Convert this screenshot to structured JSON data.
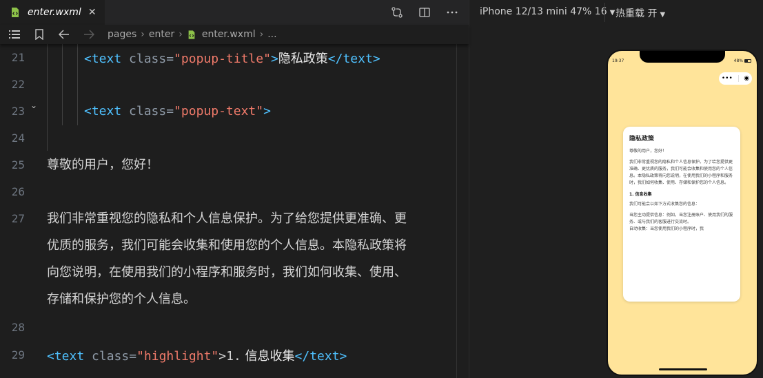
{
  "editor": {
    "tab": {
      "filename": "enter.wxml",
      "close_glyph": "✕"
    },
    "breadcrumb": {
      "items": [
        "pages",
        "enter"
      ],
      "file": "enter.wxml",
      "trail": "..."
    },
    "lines": [
      {
        "num": "21",
        "tag_open": "<text",
        "attr": "class=",
        "value": "\"popup-title\"",
        "close": ">",
        "text": "隐私政策",
        "tag_close": "</text>"
      },
      {
        "num": "22"
      },
      {
        "num": "23",
        "tag_open": "<text",
        "attr": "class=",
        "value": "\"popup-text\"",
        "close": ">"
      },
      {
        "num": "24"
      },
      {
        "num": "25",
        "prose": "尊敬的用户，您好！"
      },
      {
        "num": "26"
      },
      {
        "num": "27",
        "prose_lines": [
          "我们非常重视您的隐私和个人信息保护。为了给您提供更准确、更",
          "优质的服务，我们可能会收集和使用您的个人信息。本隐私政策将",
          "向您说明，在使用我们的小程序和服务时，我们如何收集、使用、",
          "存储和保护您的个人信息。"
        ]
      },
      {
        "num": "28"
      },
      {
        "num": "29",
        "tag_open": "<text",
        "attr": "class=",
        "value": "\"highlight\"",
        "close": ">1.",
        "text": " 信息收集",
        "tag_close": "</text>"
      }
    ]
  },
  "simulator": {
    "device": "iPhone 12/13 mini 47% 16",
    "hot_reload": "热重载 开",
    "status": {
      "time": "19:37",
      "battery": "48%"
    },
    "capsule": {
      "more": "•••",
      "close": "◉"
    },
    "popup": {
      "title": "隐私政策",
      "greeting": "尊敬的用户，您好！",
      "intro": "我们非常重视您的隐私和个人信息保护。为了给您提供更准确、更优质的服务，我们可能会收集和使用您的个人信息。本隐私政策将向您说明，在使用我们的小程序和服务时，我们如何收集、使用、存储和保护您的个人信息。",
      "section1": "1. 信息收集",
      "section1_lead": "我们可能会以如下方式收集您的信息：",
      "active": "当您主动提供信息：例如，当您注册账户、使用我们的服务、或与我们的客服进行交流时。",
      "auto": "自动收集：当您使用我们的小程序时，我"
    }
  },
  "colors": {
    "tag": "#4fc1ff",
    "string": "#f07a6a",
    "phone_bg": "#ffe49a",
    "file_icon": "#8dc149"
  }
}
